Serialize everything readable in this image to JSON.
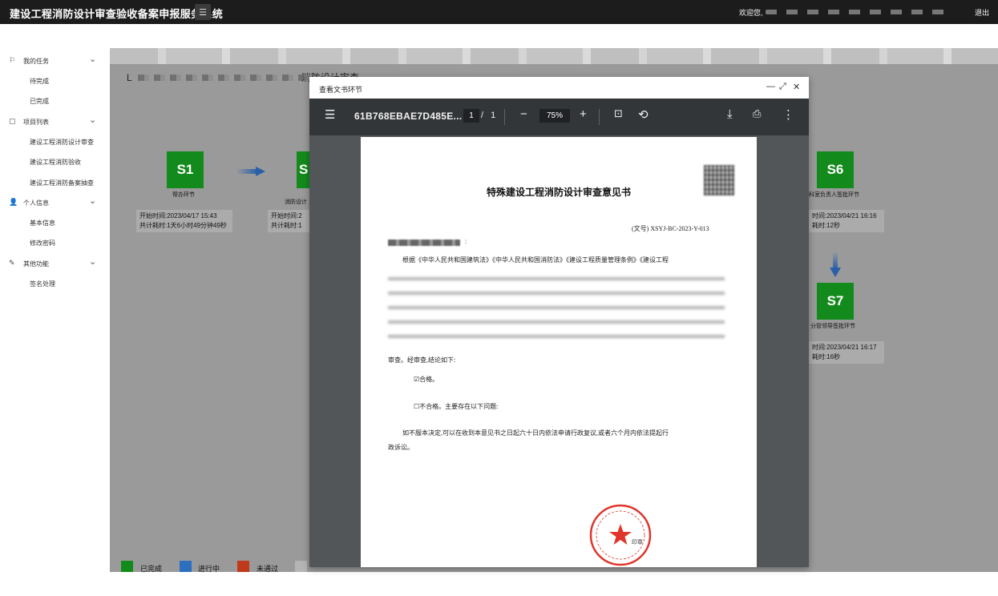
{
  "topbar": {
    "title": "建设工程消防设计审查验收备案申报服务系统",
    "menu_icon": "list-icon",
    "welcome": "欢迎您,",
    "logout": "退出"
  },
  "sidebar": {
    "groups": [
      {
        "label": "我的任务",
        "icon": "flag-icon",
        "items": [
          "待完成",
          "已完成"
        ]
      },
      {
        "label": "项目列表",
        "icon": "document-icon",
        "items": [
          "建设工程消防设计审查",
          "建设工程消防验收",
          "建设工程消防备案抽查"
        ]
      },
      {
        "label": "个人信息",
        "icon": "user-icon",
        "items": [
          "基本信息",
          "修改密码"
        ]
      },
      {
        "label": "其他功能",
        "icon": "edit-icon",
        "items": [
          "签名处理"
        ]
      }
    ]
  },
  "main": {
    "heading_prefix": "L",
    "heading_suffix": "消防设计审查",
    "steps": {
      "s1": {
        "code": "S1",
        "label": "帮办环节",
        "start_label": "开始时间:",
        "start": "2023/04/17 15:43",
        "elapsed_label": "共计耗时:",
        "elapsed": "1天6小时49分钟49秒"
      },
      "s2": {
        "code": "S",
        "label_partial": "消防设计",
        "start_label": "开始时间:",
        "start_partial": "2",
        "elapsed_label": "共计耗时:",
        "elapsed_partial": "1"
      },
      "s6": {
        "code": "S6",
        "label_partial": "科室负责人签批环节",
        "start_partial": "时间:",
        "start": "2023/04/21 16:16",
        "elapsed_partial": "耗时:",
        "elapsed": "12秒"
      },
      "s7": {
        "code": "S7",
        "label": "分管领导签批环节",
        "start_partial": "时间:",
        "start": "2023/04/21 16:17",
        "elapsed_partial": "耗时:",
        "elapsed": "16秒"
      }
    },
    "legend": [
      {
        "label": "已完成",
        "color": "#138a1c"
      },
      {
        "label": "进行中",
        "color": "#2c6fbf"
      },
      {
        "label": "未通过",
        "color": "#c0391a"
      }
    ]
  },
  "dialog": {
    "title": "查看文书环节",
    "controls": {
      "minimize": "—",
      "maximize": "⤢",
      "close": "✕"
    },
    "pdf": {
      "filename": "61B768EBAE7D485E...",
      "page_current": "1",
      "page_sep": "/",
      "page_total": "1",
      "zoom": "75%",
      "icons": [
        "menu-icon",
        "zoom-out-icon",
        "zoom-in-icon",
        "fit-page-icon",
        "rotate-icon",
        "download-icon",
        "print-icon",
        "more-icon"
      ]
    },
    "document": {
      "title": "特殊建设工程消防设计审查意见书",
      "doc_no": "(文号) XSYJ-BC-2023-Y-013",
      "colon": ":",
      "para1": "根据《中华人民共和国建筑法》《中华人民共和国消防法》《建设工程质量管理条例》《建设工程",
      "line_end": "审查。经审查,结论如下:",
      "check_pass": "☑合格。",
      "check_fail": "☐不合格。主要存在以下问题:",
      "para2": "如不服本决定,可以在收到本意见书之日起六十日内依法申请行政复议,或者六个月内依法提起行",
      "para2b": "政诉讼。",
      "seal_label": "印章"
    }
  }
}
